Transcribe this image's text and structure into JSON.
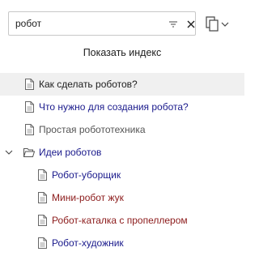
{
  "search": {
    "value": "робот",
    "placeholder": ""
  },
  "index_label": "Показать индекс",
  "tree": {
    "item0": {
      "label": "Как сделать роботов?"
    },
    "item1": {
      "label": "Что нужно для создания робота?"
    },
    "item2": {
      "label": "Простая робототехника"
    },
    "folder": {
      "label": "Идеи роботов"
    },
    "child0": {
      "label": "Робот-уборщик"
    },
    "child1": {
      "label": "Мини-робот жук"
    },
    "child2": {
      "label": "Робот-каталка с пропеллером"
    },
    "child3": {
      "label": "Робот-художник"
    }
  },
  "colors": {
    "link_blue": "#1a1a8c",
    "link_visited": "#8b1a1a",
    "text_gray": "#555555",
    "selected_bg": "#f0f0f0"
  },
  "icons": [
    "filter-icon",
    "close-icon",
    "copy-icon",
    "chevron-down-icon",
    "document-icon",
    "folder-open-icon"
  ]
}
